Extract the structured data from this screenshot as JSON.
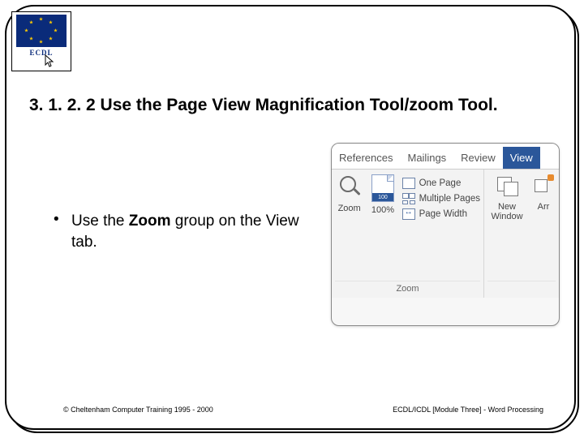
{
  "logo": {
    "acronym": "ECDL"
  },
  "title": "3. 1. 2. 2 Use the Page View Magnification Tool/zoom Tool.",
  "bullet": {
    "marker": "•",
    "pre": "Use the ",
    "bold": "Zoom",
    "post": " group on the View tab."
  },
  "ribbon": {
    "tabs": [
      "References",
      "Mailings",
      "Review",
      "View"
    ],
    "active_tab_index": 3,
    "zoom_group": {
      "label": "Zoom",
      "zoom_btn": "Zoom",
      "hundred_btn": "100%",
      "hundred_badge": "100",
      "options": [
        "One Page",
        "Multiple Pages",
        "Page Width"
      ]
    },
    "window_group": {
      "new_window": "New Window",
      "arrange": "Arr"
    }
  },
  "footer": {
    "left": "© Cheltenham Computer Training 1995 - 2000",
    "right": "ECDL/ICDL [Module Three] - Word Processing"
  }
}
